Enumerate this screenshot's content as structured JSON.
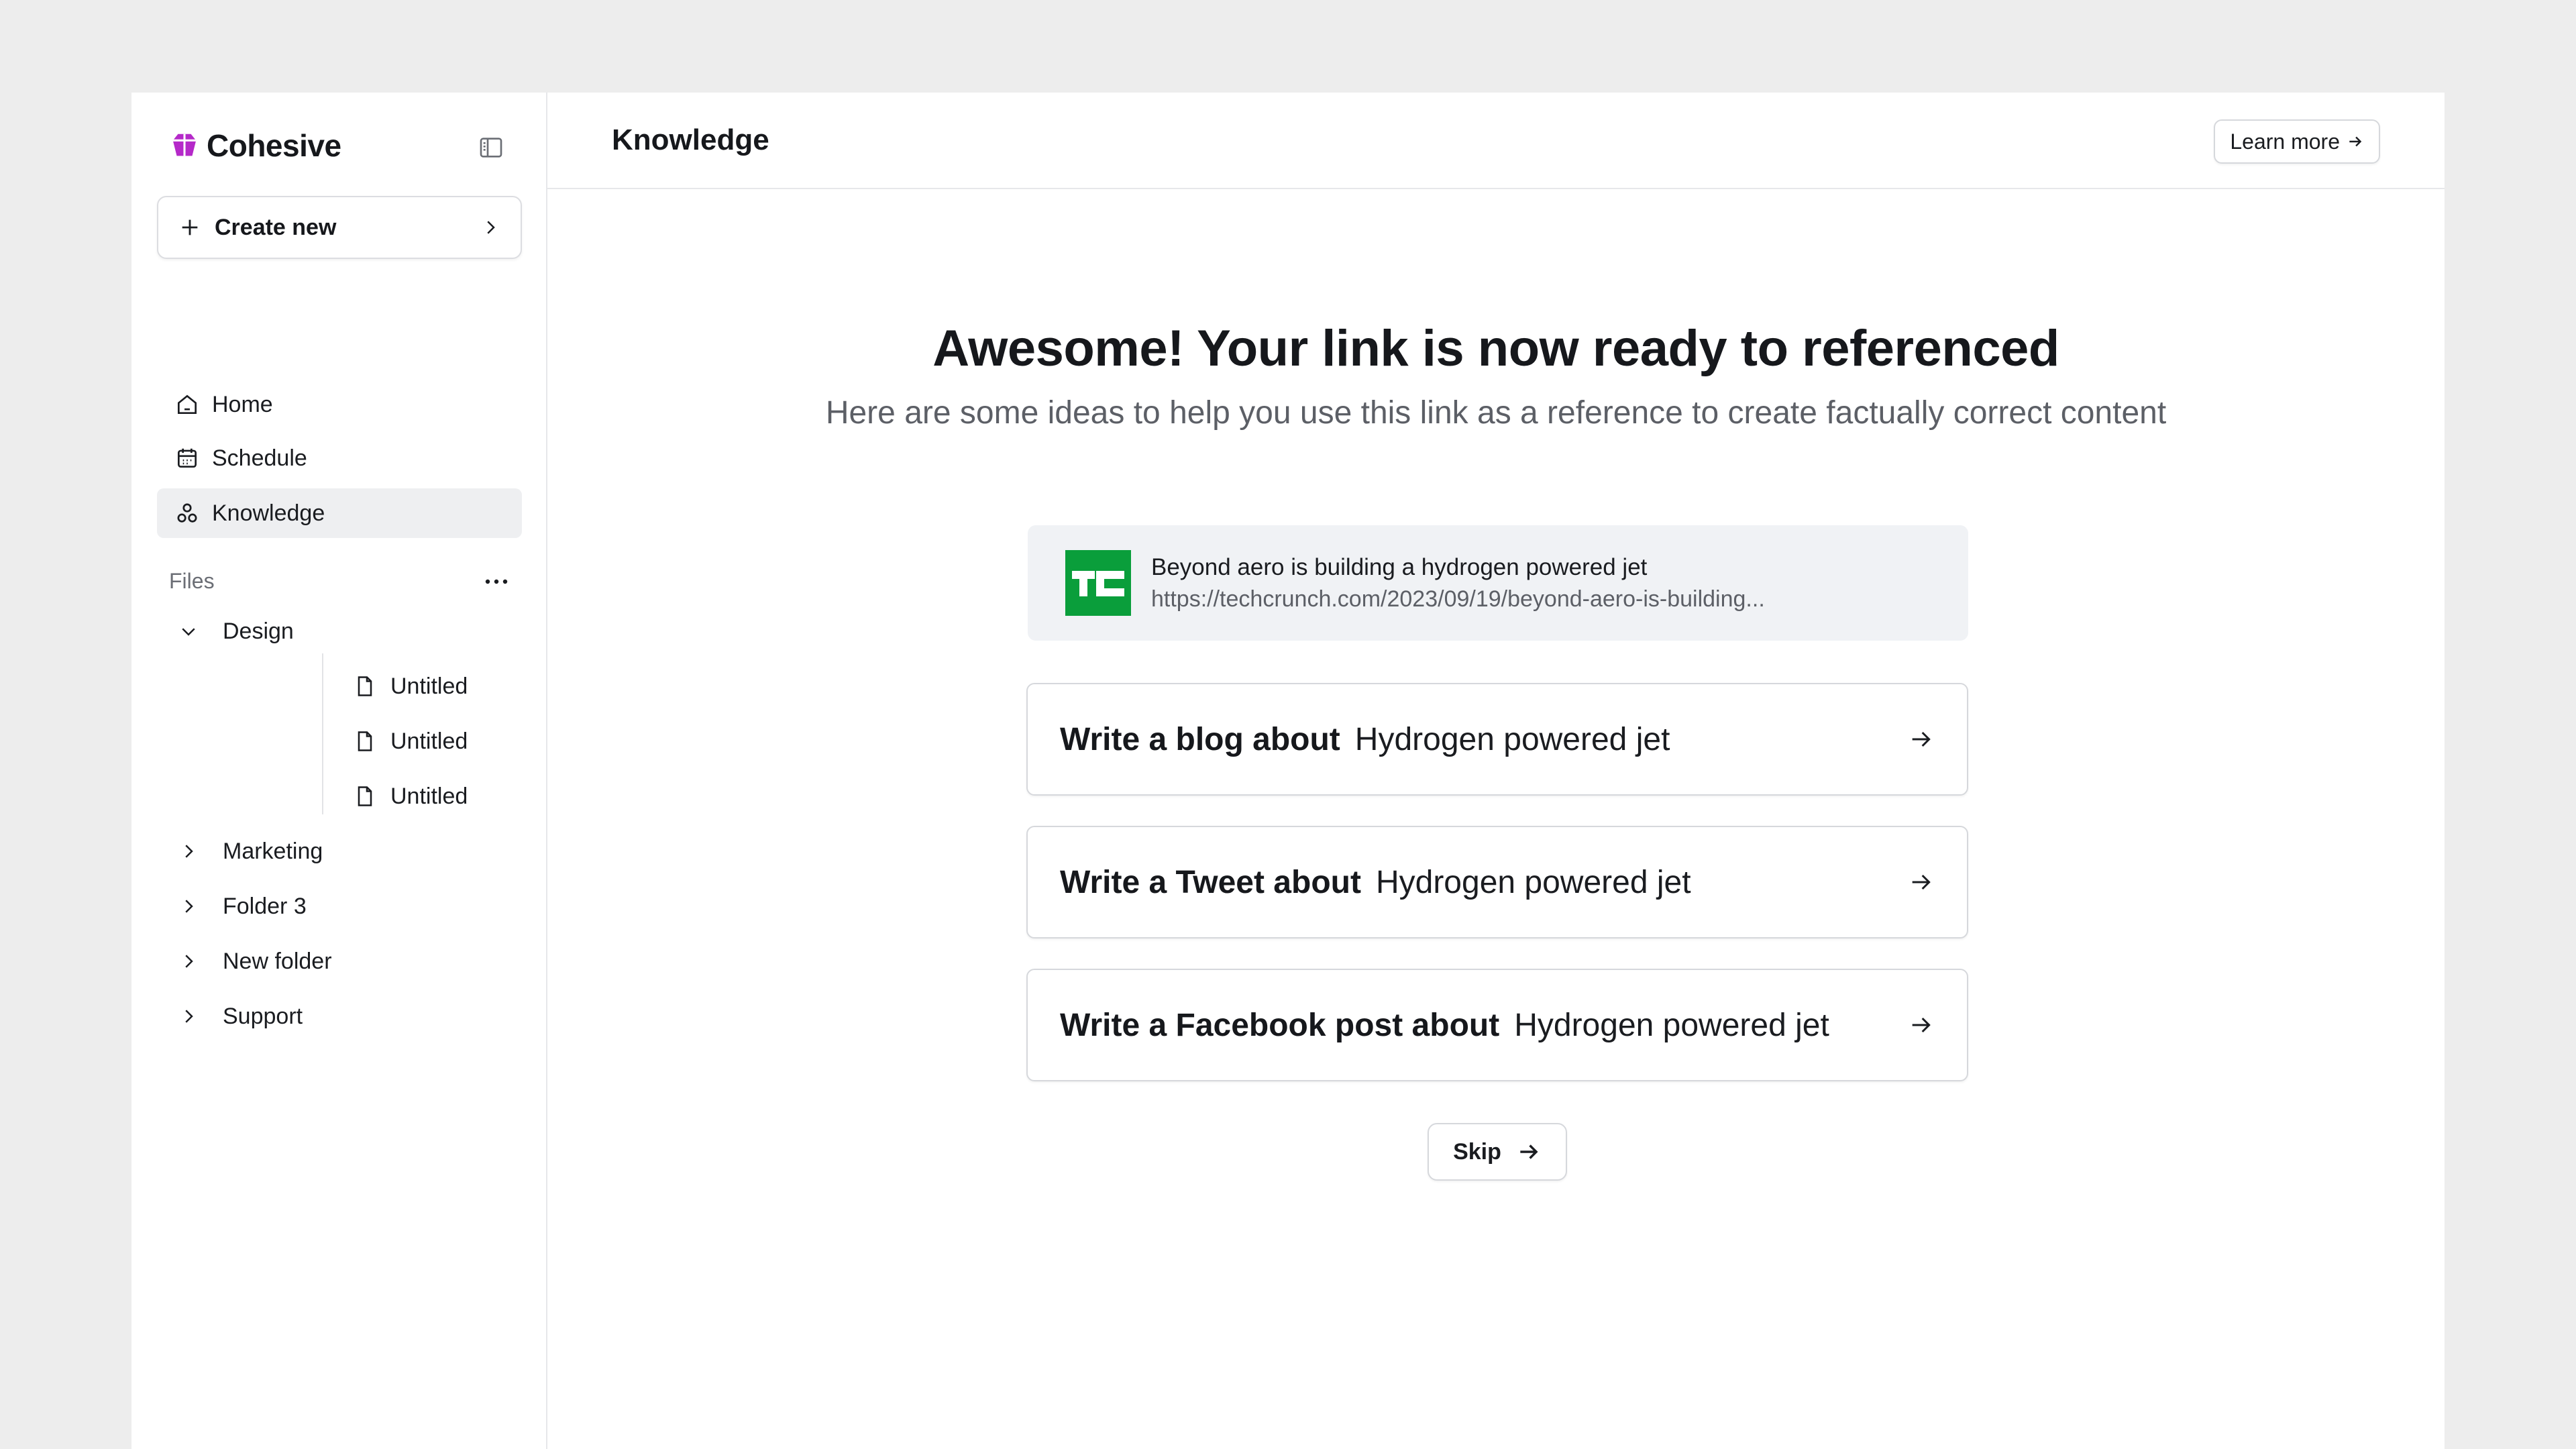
{
  "sidebar": {
    "brand": "Cohesive",
    "create_label": "Create new",
    "nav": [
      {
        "label": "Home",
        "icon": "home-icon"
      },
      {
        "label": "Schedule",
        "icon": "calendar-icon"
      },
      {
        "label": "Knowledge",
        "icon": "knowledge-icon",
        "active": true
      }
    ],
    "files_label": "Files",
    "tree": [
      {
        "label": "Design",
        "expanded": true
      },
      {
        "label": "Untitled"
      },
      {
        "label": "Untitled"
      },
      {
        "label": "Untitled"
      },
      {
        "label": "Marketing"
      },
      {
        "label": "Folder 3"
      },
      {
        "label": "New folder"
      },
      {
        "label": "Support"
      }
    ]
  },
  "header": {
    "title": "Knowledge",
    "learn_more": "Learn more"
  },
  "main": {
    "headline": "Awesome! Your link is now ready to referenced",
    "subhead": "Here are some ideas to help you use this link as a reference to create factually correct content",
    "link": {
      "title": "Beyond aero is building a hydrogen powered jet",
      "url": "https://techcrunch.com/2023/09/19/beyond-aero-is-building...",
      "logo_text": "TC"
    },
    "ideas": [
      {
        "verb": "Write a blog about",
        "topic": "Hydrogen powered jet"
      },
      {
        "verb": "Write a Tweet about",
        "topic": "Hydrogen powered jet"
      },
      {
        "verb": "Write a Facebook post about",
        "topic": "Hydrogen powered jet"
      }
    ],
    "skip": "Skip"
  },
  "colors": {
    "brand": "#b529c9",
    "logo_green": "#0a9e3b",
    "active_bg": "#eeeff1"
  }
}
